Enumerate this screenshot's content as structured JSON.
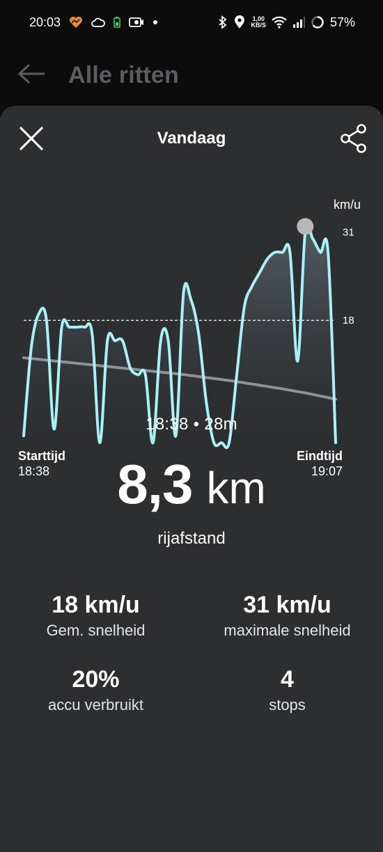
{
  "status": {
    "time": "20:03",
    "speed_value": "1,00",
    "speed_unit": "KB/S",
    "battery": "57%"
  },
  "appbar": {
    "title": "Alle ritten"
  },
  "sheet": {
    "title": "Vandaag"
  },
  "chart_data": {
    "type": "line",
    "unit": "km/u",
    "yticks": [
      31,
      18
    ],
    "average": 18,
    "max": 31,
    "ylim": [
      0,
      34
    ],
    "series": [
      {
        "values": [
          1,
          14,
          19,
          18,
          2,
          17,
          17,
          17,
          17,
          16,
          0,
          15,
          15,
          15,
          11,
          10,
          10,
          0,
          15,
          15,
          1,
          22,
          21,
          16,
          6,
          0,
          0,
          0,
          10,
          20,
          23,
          25,
          27,
          28,
          28,
          28,
          12,
          31,
          30,
          28,
          28,
          0
        ]
      },
      {
        "values": [
          12.5,
          12.1,
          11.7,
          11.3,
          10.9,
          10.5,
          10.1,
          9.6,
          9.1,
          8.5,
          7.9,
          7.2,
          6.4
        ]
      }
    ]
  },
  "start": {
    "label": "Starttijd",
    "time": "18:38"
  },
  "end": {
    "label": "Eindtijd",
    "time": "19:07"
  },
  "summary": {
    "time": "18:38 • 28m",
    "distance_value": "8,3",
    "distance_unit": "km",
    "distance_label": "rijafstand"
  },
  "stats": [
    {
      "value": "18 km/u",
      "label": "Gem. snelheid"
    },
    {
      "value": "31 km/u",
      "label": "maximale snelheid"
    },
    {
      "value": "20%",
      "label": "accu verbruikt"
    },
    {
      "value": "4",
      "label": "stops"
    }
  ],
  "colors": {
    "line": "#a8f1f4",
    "trend": "#8f9194",
    "sheet": "#2c2e30"
  }
}
